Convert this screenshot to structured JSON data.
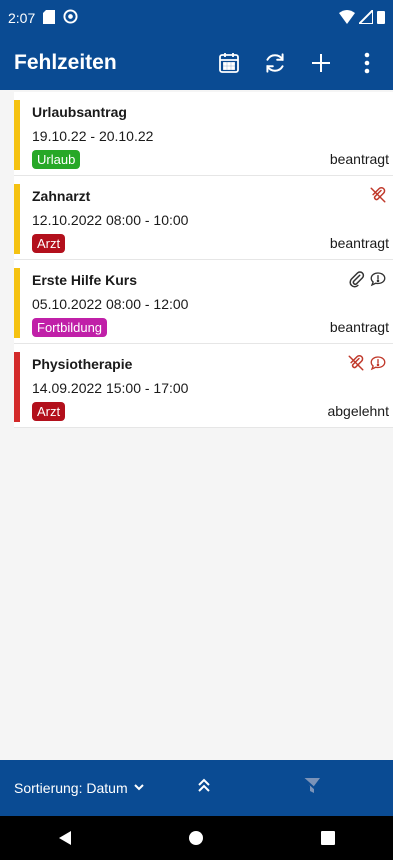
{
  "status_bar": {
    "time": "2:07"
  },
  "app_bar": {
    "title": "Fehlzeiten"
  },
  "items": [
    {
      "title": "Urlaubsantrag",
      "dates": "19.10.22 - 20.10.22",
      "category": "Urlaub",
      "status": "beantragt",
      "bar_color": "#f5c211",
      "badge_color": "#27a827",
      "icons": []
    },
    {
      "title": "Zahnarzt",
      "dates": "12.10.2022   08:00 - 10:00",
      "category": "Arzt",
      "status": "beantragt",
      "bar_color": "#f5c211",
      "badge_color": "#b3101c",
      "icons": [
        "no-attachment-icon"
      ]
    },
    {
      "title": "Erste Hilfe Kurs",
      "dates": "05.10.2022   08:00 - 12:00",
      "category": "Fortbildung",
      "status": "beantragt",
      "bar_color": "#f5c211",
      "badge_color": "#c020a8",
      "icons": [
        "attachment-icon",
        "comment-icon"
      ]
    },
    {
      "title": "Physiotherapie",
      "dates": "14.09.2022   15:00 - 17:00",
      "category": "Arzt",
      "status": "abgelehnt",
      "bar_color": "#d32a2a",
      "badge_color": "#b3101c",
      "icons": [
        "no-attachment-icon",
        "comment-alert-icon"
      ]
    }
  ],
  "bottom_bar": {
    "sort_label": "Sortierung: Datum"
  }
}
